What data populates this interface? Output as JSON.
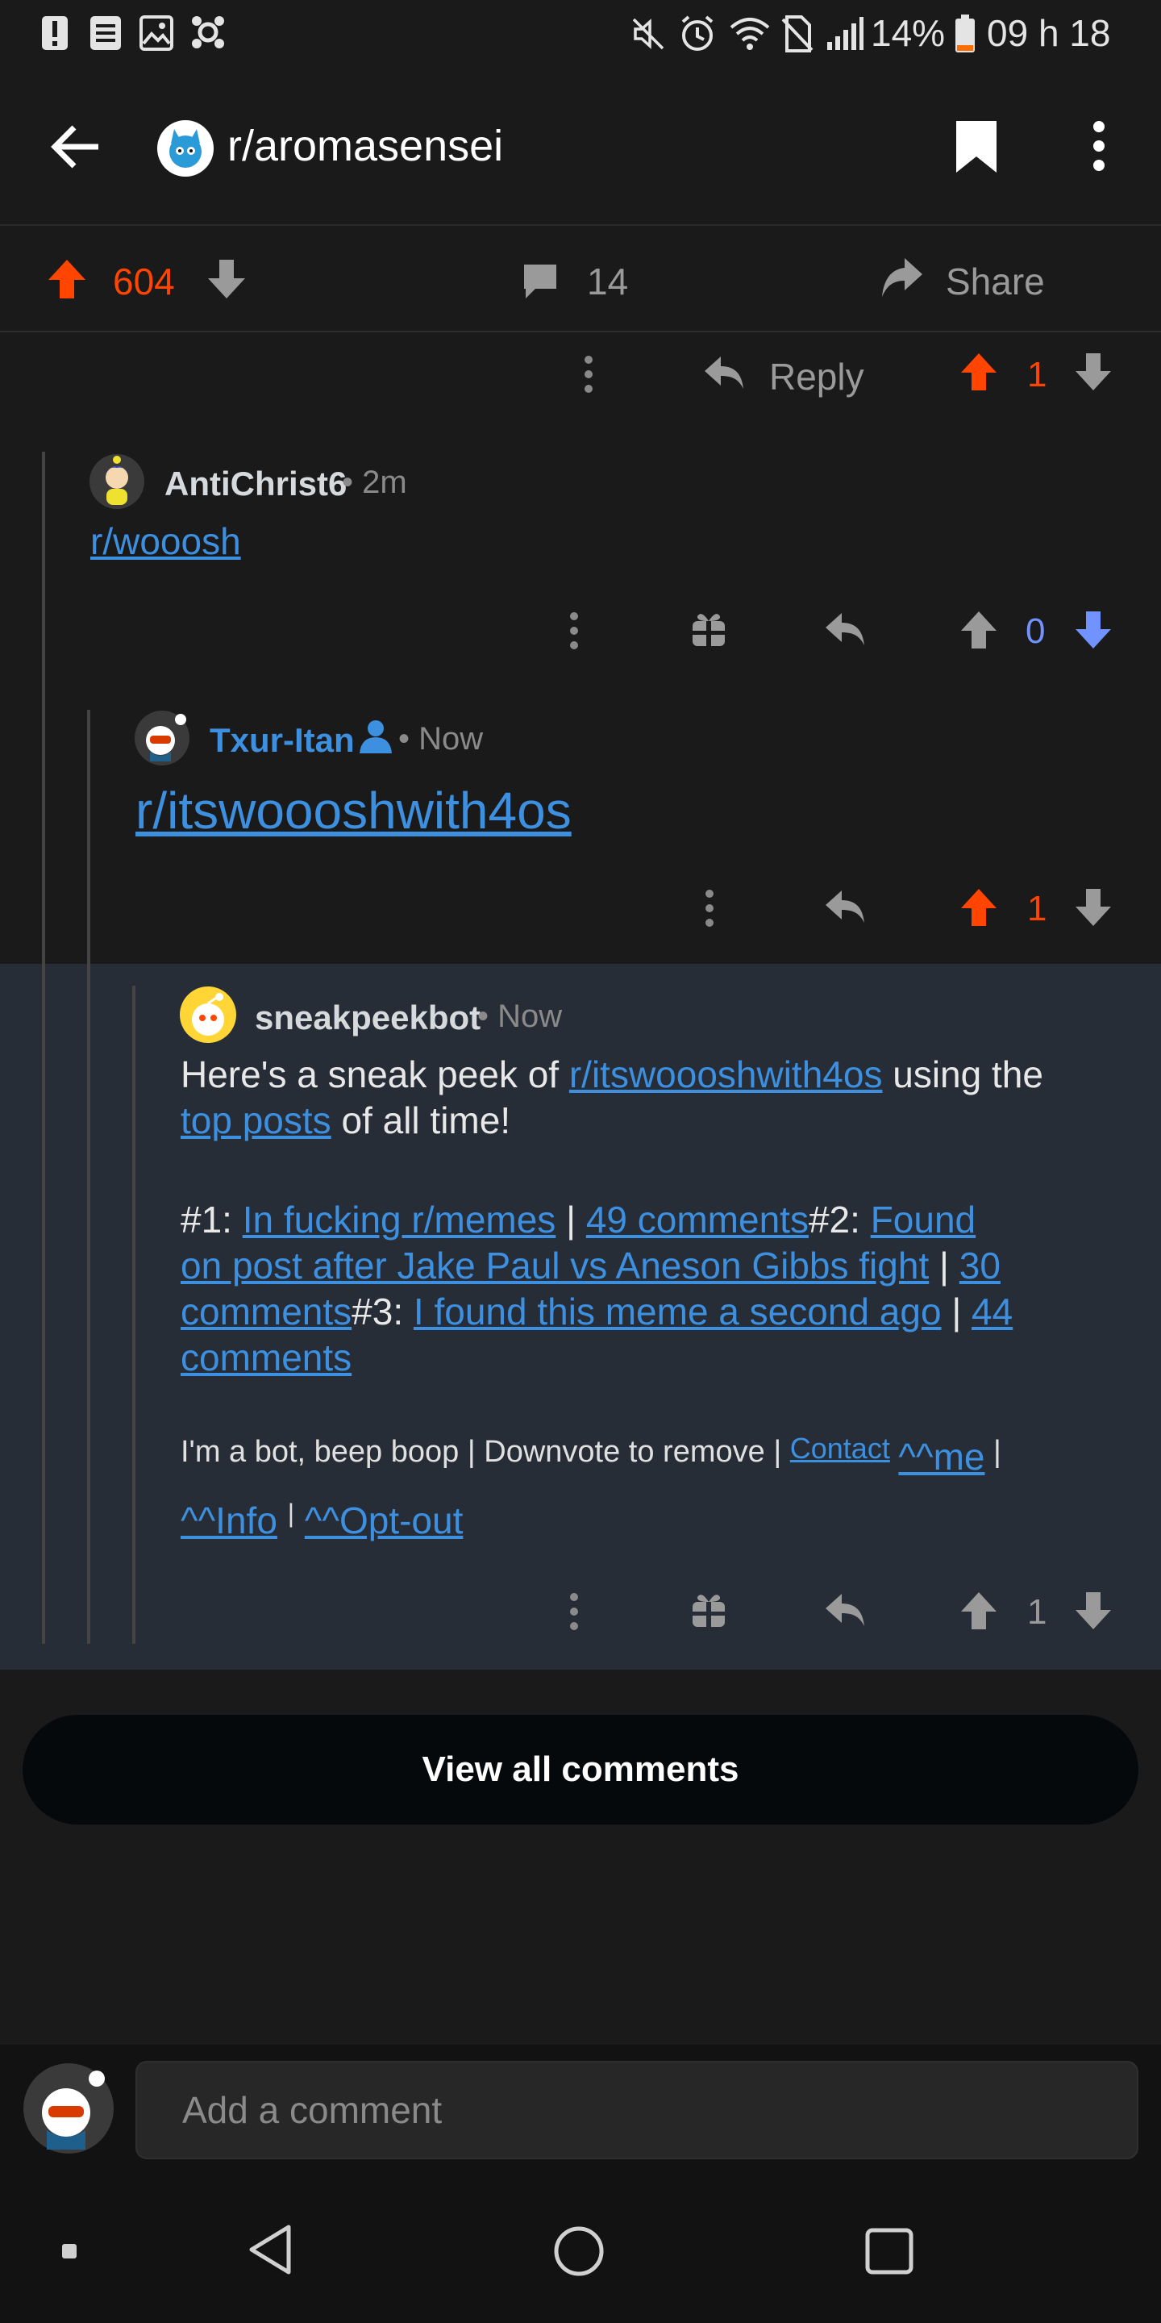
{
  "status_bar": {
    "battery": "14%",
    "time": "09 h 18"
  },
  "header": {
    "subreddit": "r/aromasensei"
  },
  "post_actions": {
    "score": "604",
    "comments": "14",
    "share_label": "Share"
  },
  "top_reply_row": {
    "reply_label": "Reply",
    "score": "1"
  },
  "comments": [
    {
      "username": "AntiChrist6",
      "age": "2m",
      "body_link": "r/wooosh",
      "score": "0"
    },
    {
      "username": "Txur-Itan",
      "age": "Now",
      "body_link": "r/itswoooshwith4os",
      "score": "1"
    },
    {
      "username": "sneakpeekbot",
      "age": "Now",
      "intro_1": "Here's a sneak peek of",
      "intro_link": "r/itswoooshwith4os",
      "intro_2": "using the",
      "intro_link2": "top posts",
      "intro_3": "of all time!",
      "posts": {
        "p1_prefix": "#1:",
        "p1_title": "In fucking r/memes",
        "p1_comments": "49 comments",
        "p2_prefix": "#2:",
        "p2_title_a": "Found",
        "p2_title_b": "on post after Jake Paul vs Aneson Gibbs fight",
        "p2_comments_a": "30",
        "p2_comments_b": "comments",
        "p3_prefix": "#3:",
        "p3_title": "I found this meme a second ago",
        "p3_comments_a": "44",
        "p3_comments_b": "comments",
        "sep": "|"
      },
      "footer_text": "I'm a bot, beep boop | Downvote to remove |",
      "footer_contact": "Contact",
      "footer_me": "^^me",
      "footer_pipe": "|",
      "footer_info": "^^Info",
      "footer_optout": "^^Opt-out",
      "score": "1"
    }
  ],
  "view_all_label": "View all comments",
  "add_comment_placeholder": "Add a comment",
  "colors": {
    "upvote": "#ff4500",
    "downvote": "#7193ff",
    "link": "#3d8fe0",
    "highlight_bg": "#272d36"
  }
}
